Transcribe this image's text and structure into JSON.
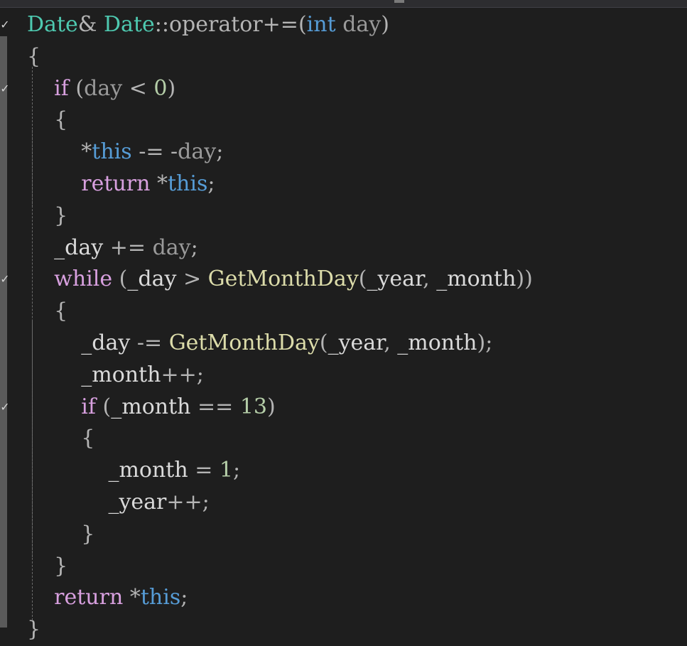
{
  "editor": {
    "lines": [
      {
        "indent": "",
        "tokens": [
          {
            "t": "Date",
            "c": "type"
          },
          {
            "t": "& ",
            "c": "op"
          },
          {
            "t": "Date",
            "c": "type"
          },
          {
            "t": "::operator+=",
            "c": "op"
          },
          {
            "t": "(",
            "c": "punct"
          },
          {
            "t": "int",
            "c": "kw"
          },
          {
            "t": " ",
            "c": "punct"
          },
          {
            "t": "day",
            "c": "param"
          },
          {
            "t": ")",
            "c": "punct"
          }
        ]
      },
      {
        "indent": "",
        "tokens": [
          {
            "t": "{",
            "c": "punct"
          }
        ]
      },
      {
        "indent": "    ",
        "tokens": [
          {
            "t": "if",
            "c": "ctl"
          },
          {
            "t": " (",
            "c": "punct"
          },
          {
            "t": "day",
            "c": "param"
          },
          {
            "t": " < ",
            "c": "op"
          },
          {
            "t": "0",
            "c": "num"
          },
          {
            "t": ")",
            "c": "punct"
          }
        ]
      },
      {
        "indent": "    ",
        "tokens": [
          {
            "t": "{",
            "c": "punct"
          }
        ]
      },
      {
        "indent": "        ",
        "tokens": [
          {
            "t": "*",
            "c": "op"
          },
          {
            "t": "this",
            "c": "kw"
          },
          {
            "t": " -= -",
            "c": "op"
          },
          {
            "t": "day",
            "c": "param"
          },
          {
            "t": ";",
            "c": "punct"
          }
        ]
      },
      {
        "indent": "        ",
        "tokens": [
          {
            "t": "return",
            "c": "ctl"
          },
          {
            "t": " *",
            "c": "op"
          },
          {
            "t": "this",
            "c": "kw"
          },
          {
            "t": ";",
            "c": "punct"
          }
        ]
      },
      {
        "indent": "    ",
        "tokens": [
          {
            "t": "}",
            "c": "punct"
          }
        ]
      },
      {
        "indent": "    ",
        "tokens": [
          {
            "t": "_day",
            "c": "field"
          },
          {
            "t": " += ",
            "c": "op"
          },
          {
            "t": "day",
            "c": "param"
          },
          {
            "t": ";",
            "c": "punct"
          }
        ]
      },
      {
        "indent": "    ",
        "tokens": [
          {
            "t": "while",
            "c": "ctl"
          },
          {
            "t": " (",
            "c": "punct"
          },
          {
            "t": "_day",
            "c": "field"
          },
          {
            "t": " > ",
            "c": "op"
          },
          {
            "t": "GetMonthDay",
            "c": "fn"
          },
          {
            "t": "(",
            "c": "punct"
          },
          {
            "t": "_year",
            "c": "field"
          },
          {
            "t": ", ",
            "c": "punct"
          },
          {
            "t": "_month",
            "c": "field"
          },
          {
            "t": "))",
            "c": "punct"
          }
        ]
      },
      {
        "indent": "    ",
        "tokens": [
          {
            "t": "{",
            "c": "punct"
          }
        ]
      },
      {
        "indent": "        ",
        "tokens": [
          {
            "t": "_day",
            "c": "field"
          },
          {
            "t": " -= ",
            "c": "op"
          },
          {
            "t": "GetMonthDay",
            "c": "fn"
          },
          {
            "t": "(",
            "c": "punct"
          },
          {
            "t": "_year",
            "c": "field"
          },
          {
            "t": ", ",
            "c": "punct"
          },
          {
            "t": "_month",
            "c": "field"
          },
          {
            "t": ");",
            "c": "punct"
          }
        ]
      },
      {
        "indent": "        ",
        "tokens": [
          {
            "t": "_month",
            "c": "field"
          },
          {
            "t": "++;",
            "c": "op"
          }
        ]
      },
      {
        "indent": "        ",
        "tokens": [
          {
            "t": "if",
            "c": "ctl"
          },
          {
            "t": " (",
            "c": "punct"
          },
          {
            "t": "_month",
            "c": "field"
          },
          {
            "t": " == ",
            "c": "op"
          },
          {
            "t": "13",
            "c": "num"
          },
          {
            "t": ")",
            "c": "punct"
          }
        ]
      },
      {
        "indent": "        ",
        "tokens": [
          {
            "t": "{",
            "c": "punct"
          }
        ]
      },
      {
        "indent": "            ",
        "tokens": [
          {
            "t": "_month",
            "c": "field"
          },
          {
            "t": " = ",
            "c": "op"
          },
          {
            "t": "1",
            "c": "num"
          },
          {
            "t": ";",
            "c": "punct"
          }
        ]
      },
      {
        "indent": "            ",
        "tokens": [
          {
            "t": "_year",
            "c": "field"
          },
          {
            "t": "++;",
            "c": "op"
          }
        ]
      },
      {
        "indent": "        ",
        "tokens": [
          {
            "t": "}",
            "c": "punct"
          }
        ]
      },
      {
        "indent": "    ",
        "tokens": [
          {
            "t": "}",
            "c": "punct"
          }
        ]
      },
      {
        "indent": "    ",
        "tokens": [
          {
            "t": "return",
            "c": "ctl"
          },
          {
            "t": " *",
            "c": "op"
          },
          {
            "t": "this",
            "c": "kw"
          },
          {
            "t": ";",
            "c": "punct"
          }
        ]
      },
      {
        "indent": "",
        "tokens": [
          {
            "t": "}",
            "c": "punct"
          }
        ]
      }
    ],
    "fold_lines": [
      0,
      2,
      8,
      12
    ],
    "fold_glyph": "✓",
    "colors": {
      "background": "#1e1e1e",
      "type": "#4ec9b0",
      "keyword": "#569cd6",
      "control": "#d8a0df",
      "function": "#dcdcaa",
      "parameter": "#9a9a9a",
      "number": "#b5cea8",
      "field": "#dadada",
      "operator": "#b4b4b4"
    }
  }
}
